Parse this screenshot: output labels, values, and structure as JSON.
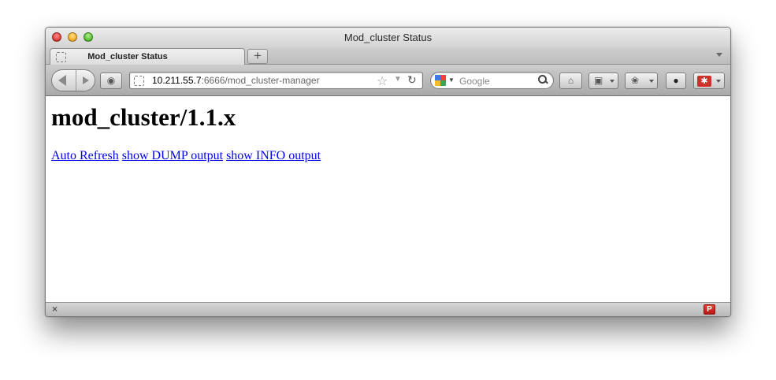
{
  "window": {
    "title": "Mod_cluster Status"
  },
  "tab": {
    "label": "Mod_cluster Status",
    "new_tab_symbol": "+"
  },
  "toolbar": {
    "url_host": "10.211.55.7",
    "url_rest": ":6666/mod_cluster-manager",
    "search_placeholder": "Google",
    "icons": [
      "back-icon",
      "forward-icon",
      "tab-overview-icon",
      "bookmark-star-icon",
      "reload-icon",
      "google-icon",
      "magnifier-icon",
      "home-icon",
      "bookmarks-icon",
      "extension-icon",
      "evernote-icon",
      "addon-icon"
    ]
  },
  "page": {
    "heading": "mod_cluster/1.1.x",
    "links": [
      "Auto Refresh",
      "show DUMP output",
      "show INFO output"
    ]
  },
  "statusbar": {
    "close_symbol": "×",
    "addon_label": "P"
  },
  "colors": {
    "link": "#0000ee",
    "addon_red": "#d0302a"
  }
}
